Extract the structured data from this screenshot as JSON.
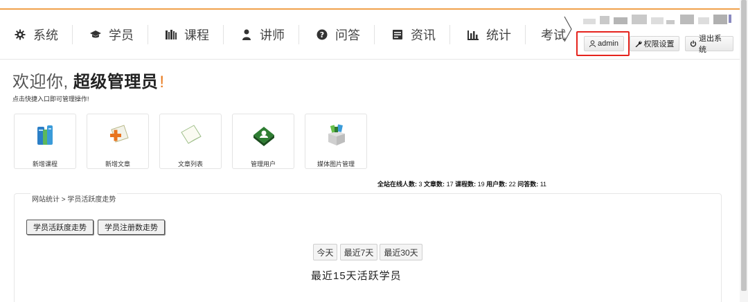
{
  "nav": {
    "items": [
      {
        "label": "系统",
        "icon": "gear-icon"
      },
      {
        "label": "学员",
        "icon": "graduation-cap-icon"
      },
      {
        "label": "课程",
        "icon": "library-icon"
      },
      {
        "label": "讲师",
        "icon": "user-icon"
      },
      {
        "label": "问答",
        "icon": "question-circle-icon"
      },
      {
        "label": "资讯",
        "icon": "newspaper-icon"
      },
      {
        "label": "统计",
        "icon": "bar-chart-icon"
      },
      {
        "label": "考试",
        "icon": ""
      }
    ]
  },
  "user_bar": {
    "admin_label": "admin",
    "permission_label": "权限设置",
    "logout_label": "退出系统"
  },
  "welcome": {
    "prefix": "欢迎你,",
    "role": "超级管理员",
    "suffix": "!",
    "subtitle": "点击快捷入口即可管理操作!"
  },
  "shortcuts": [
    {
      "label": "新增课程",
      "icon": "books-icon"
    },
    {
      "label": "新增文章",
      "icon": "add-document-icon"
    },
    {
      "label": "文章列表",
      "icon": "document-list-icon"
    },
    {
      "label": "管理用户",
      "icon": "user-book-icon"
    },
    {
      "label": "媒体图片管理",
      "icon": "media-box-icon"
    }
  ],
  "stats": {
    "online_label": "全站在线人数:",
    "online_value": "3",
    "article_label": "文章数:",
    "article_value": "17",
    "course_label": "课程数:",
    "course_value": "19",
    "user_label": "用户数:",
    "user_value": "22",
    "qa_label": "问答数:",
    "qa_value": "11"
  },
  "panel": {
    "breadcrumb": "网站统计 > 学员活跃度走势",
    "tabs": [
      "学员活跃度走势",
      "学员注册数走势"
    ],
    "ranges": [
      "今天",
      "最近7天",
      "最近30天"
    ],
    "chart_title": "最近15天活跃学员"
  },
  "colors": {
    "accent_line": "#f0a14a",
    "highlight_border": "#e5231d",
    "welcome_exclaim": "#e87a1e"
  }
}
